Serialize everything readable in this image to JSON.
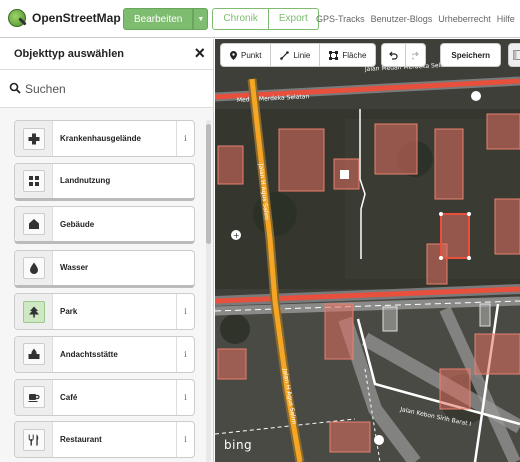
{
  "app": {
    "title": "OpenStreetMap"
  },
  "topbar": {
    "edit_label": "Bearbeiten",
    "history_label": "Chronik",
    "export_label": "Export",
    "links": [
      "GPS-Tracks",
      "Benutzer-Blogs",
      "Urheberrecht",
      "Hilfe"
    ]
  },
  "sidebar": {
    "title": "Objekttyp auswählen",
    "close_glyph": "×",
    "search_placeholder": "Suchen",
    "presets": [
      {
        "label": "Krankenhausgelände",
        "icon": "cross-icon",
        "info": "i"
      },
      {
        "label": "Landnutzung",
        "icon": "landuse-icon"
      },
      {
        "label": "Gebäude",
        "icon": "building-icon"
      },
      {
        "label": "Wasser",
        "icon": "water-drop-icon"
      },
      {
        "label": "Park",
        "icon": "tree-icon",
        "info": "i"
      },
      {
        "label": "Andachtsstätte",
        "icon": "place-of-worship-icon",
        "info": "i"
      },
      {
        "label": "Café",
        "icon": "coffee-cup-icon",
        "info": "i"
      },
      {
        "label": "Restaurant",
        "icon": "fork-knife-icon",
        "info": "i"
      }
    ]
  },
  "map_toolbar": {
    "point_label": "Punkt",
    "line_label": "Linie",
    "area_label": "Fläche",
    "save_label": "Speichern"
  },
  "map": {
    "attribution": "bing",
    "roads": [
      "Jalan Medan Merdeka Selatan",
      "Medan Merdeka Selatan",
      "Jalan H Agus Salim",
      "Jalan H Agus Salim",
      "Jalan Kebon Sirih Barat I"
    ]
  },
  "colors": {
    "accent": "#7ebc6f",
    "road_main": "#e8503d",
    "road_secondary": "#f5a623",
    "building_fill": "#e07060"
  }
}
